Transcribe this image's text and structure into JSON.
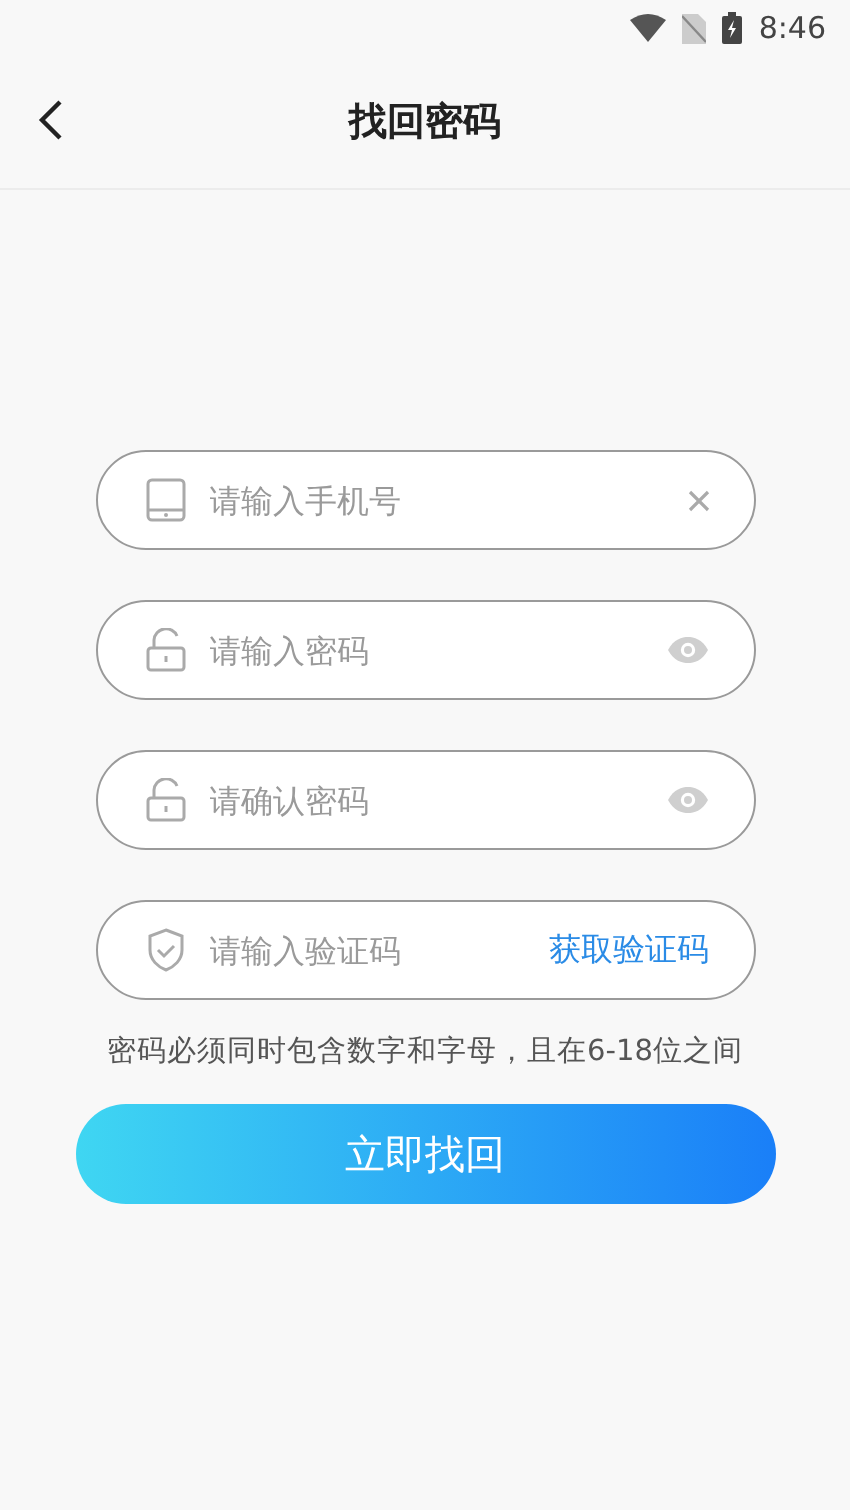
{
  "status_bar": {
    "time": "8:46"
  },
  "header": {
    "title": "找回密码"
  },
  "fields": [
    {
      "kind": "phone",
      "placeholder": "请输入手机号",
      "trailing": {
        "kind": "clear"
      }
    },
    {
      "kind": "password",
      "placeholder": "请输入密码",
      "trailing": {
        "kind": "eye"
      }
    },
    {
      "kind": "password",
      "placeholder": "请确认密码",
      "trailing": {
        "kind": "eye"
      }
    },
    {
      "kind": "code",
      "placeholder": "请输入验证码",
      "trailing": {
        "kind": "link",
        "label": "获取验证码"
      }
    }
  ],
  "hint": "密码必须同时包含数字和字母，且在6-18位之间",
  "submit_button": "立即找回"
}
